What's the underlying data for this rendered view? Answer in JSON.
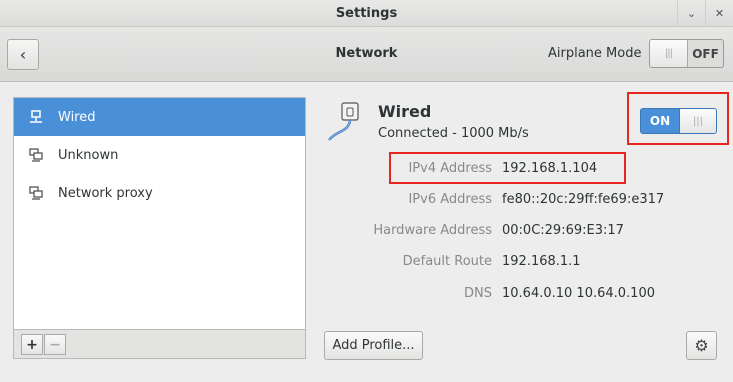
{
  "window": {
    "title": "Settings",
    "window_buttons": [
      "⌄",
      "✕"
    ]
  },
  "header": {
    "back_icon": "‹",
    "title": "Network",
    "airplane_label": "Airplane Mode",
    "airplane_toggle_text": "OFF",
    "airplane_toggle_knob": "|||"
  },
  "sidebar": {
    "items": [
      {
        "label": "Wired",
        "icon": "wired-network-icon",
        "selected": true
      },
      {
        "label": "Unknown",
        "icon": "network-icon",
        "selected": false
      },
      {
        "label": "Network proxy",
        "icon": "network-proxy-icon",
        "selected": false
      }
    ],
    "add_label": "+",
    "remove_label": "−"
  },
  "device": {
    "name": "Wired",
    "status": "Connected - 1000 Mb/s",
    "toggle_text": "ON",
    "toggle_knob": "|||"
  },
  "details": [
    {
      "label": "IPv4 Address",
      "value": "192.168.1.104"
    },
    {
      "label": "IPv6 Address",
      "value": "fe80::20c:29ff:fe69:e317"
    },
    {
      "label": "Hardware Address",
      "value": "00:0C:29:69:E3:17"
    },
    {
      "label": "Default Route",
      "value": "192.168.1.1"
    },
    {
      "label": "DNS",
      "value": "10.64.0.10 10.64.0.100"
    }
  ],
  "footer": {
    "add_profile_label": "Add Profile...",
    "settings_icon": "⚙"
  },
  "colors": {
    "accent": "#4a90d9",
    "highlight_box": "#e8261e"
  }
}
